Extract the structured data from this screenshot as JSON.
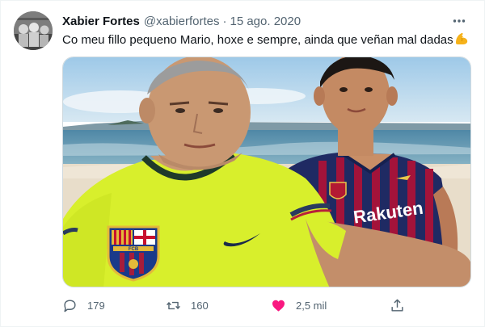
{
  "tweet": {
    "display_name": "Xabier Fortes",
    "handle": "@xabierfortes",
    "separator": "·",
    "timestamp": "15 ago. 2020",
    "text": "Co meu fillo pequeno Mario, hoxe e sempre, ainda que veñan mal dadas",
    "text_emoji": "flexed-biceps-icon",
    "media_alt": "Selfie of a father and son on a beach wearing FC Barcelona shirts",
    "jersey_text": "Rakuten",
    "crest_letters": "FCB"
  },
  "actions": {
    "reply_count": "179",
    "retweet_count": "160",
    "like_count": "2,5 mil",
    "like_icon": "heart-icon",
    "reply_icon": "reply-icon",
    "retweet_icon": "retweet-icon",
    "share_icon": "share-icon"
  },
  "colors": {
    "text_primary": "#0f1419",
    "text_secondary": "#536471",
    "like_active": "#f91880",
    "border": "#cfd9de"
  }
}
